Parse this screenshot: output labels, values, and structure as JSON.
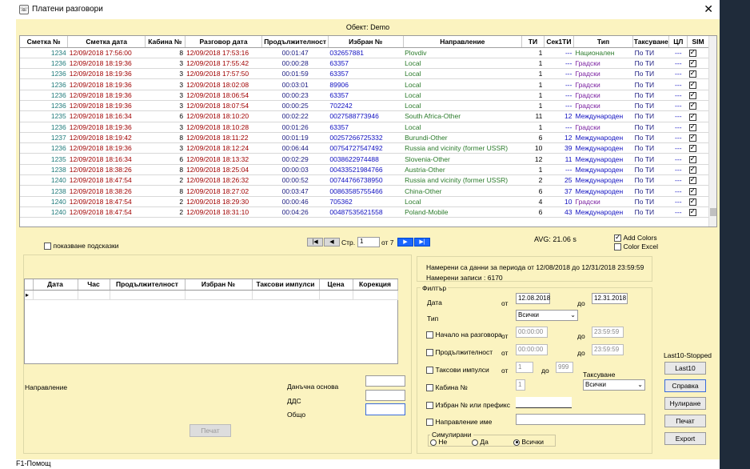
{
  "window": {
    "title": "Платени разговори",
    "close_glyph": "✕",
    "app_icon": "phone-icon"
  },
  "object_label": "Обект: Demo",
  "grid": {
    "columns": [
      "Сметка №",
      "Сметка дата",
      "Кабина №",
      "Разговор дата",
      "Продължителност",
      "Избран №",
      "Направление",
      "ТИ",
      "Сек1ТИ",
      "Тип",
      "Таксуване",
      "ЦЛ",
      "SIM"
    ],
    "rows": [
      {
        "acct": "1234",
        "acct_date": "12/09/2018  17:56:00",
        "booth": "8",
        "call_date": "12/09/2018  17:53:16",
        "dur": "00:01:47",
        "num": "032657881",
        "dest": "Plovdiv",
        "ti": "1",
        "sec": "---",
        "type": "Национален",
        "tax": "По ТИ",
        "cl": "---",
        "sim": true
      },
      {
        "acct": "1236",
        "acct_date": "12/09/2018  18:19:36",
        "booth": "3",
        "call_date": "12/09/2018  17:55:42",
        "dur": "00:00:28",
        "num": "63357",
        "dest": "Local",
        "ti": "1",
        "sec": "---",
        "type": "Градски",
        "tax": "По ТИ",
        "cl": "---",
        "sim": true
      },
      {
        "acct": "1236",
        "acct_date": "12/09/2018  18:19:36",
        "booth": "3",
        "call_date": "12/09/2018  17:57:50",
        "dur": "00:01:59",
        "num": "63357",
        "dest": "Local",
        "ti": "1",
        "sec": "---",
        "type": "Градски",
        "tax": "По ТИ",
        "cl": "---",
        "sim": true
      },
      {
        "acct": "1236",
        "acct_date": "12/09/2018  18:19:36",
        "booth": "3",
        "call_date": "12/09/2018  18:02:08",
        "dur": "00:03:01",
        "num": "89906",
        "dest": "Local",
        "ti": "1",
        "sec": "---",
        "type": "Градски",
        "tax": "По ТИ",
        "cl": "---",
        "sim": true
      },
      {
        "acct": "1236",
        "acct_date": "12/09/2018  18:19:36",
        "booth": "3",
        "call_date": "12/09/2018  18:06:54",
        "dur": "00:00:23",
        "num": "63357",
        "dest": "Local",
        "ti": "1",
        "sec": "---",
        "type": "Градски",
        "tax": "По ТИ",
        "cl": "---",
        "sim": true
      },
      {
        "acct": "1236",
        "acct_date": "12/09/2018  18:19:36",
        "booth": "3",
        "call_date": "12/09/2018  18:07:54",
        "dur": "00:00:25",
        "num": "702242",
        "dest": "Local",
        "ti": "1",
        "sec": "---",
        "type": "Градски",
        "tax": "По ТИ",
        "cl": "---",
        "sim": true
      },
      {
        "acct": "1235",
        "acct_date": "12/09/2018  18:16:34",
        "booth": "6",
        "call_date": "12/09/2018  18:10:20",
        "dur": "00:02:22",
        "num": "0027588773946",
        "dest": "South Africa-Other",
        "ti": "11",
        "sec": "12",
        "type": "Международен",
        "tax": "По ТИ",
        "cl": "---",
        "sim": true
      },
      {
        "acct": "1236",
        "acct_date": "12/09/2018  18:19:36",
        "booth": "3",
        "call_date": "12/09/2018  18:10:28",
        "dur": "00:01:26",
        "num": "63357",
        "dest": "Local",
        "ti": "1",
        "sec": "---",
        "type": "Градски",
        "tax": "По ТИ",
        "cl": "---",
        "sim": true
      },
      {
        "acct": "1237",
        "acct_date": "12/09/2018  18:19:42",
        "booth": "8",
        "call_date": "12/09/2018  18:11:22",
        "dur": "00:01:19",
        "num": "00257266725332",
        "dest": "Burundi-Other",
        "ti": "6",
        "sec": "12",
        "type": "Международен",
        "tax": "По ТИ",
        "cl": "---",
        "sim": true
      },
      {
        "acct": "1236",
        "acct_date": "12/09/2018  18:19:36",
        "booth": "3",
        "call_date": "12/09/2018  18:12:24",
        "dur": "00:06:44",
        "num": "00754727547492",
        "dest": "Russia and vicinity (former USSR)",
        "ti": "10",
        "sec": "39",
        "type": "Международен",
        "tax": "По ТИ",
        "cl": "---",
        "sim": true
      },
      {
        "acct": "1235",
        "acct_date": "12/09/2018  18:16:34",
        "booth": "6",
        "call_date": "12/09/2018  18:13:32",
        "dur": "00:02:29",
        "num": "0038622974488",
        "dest": "Slovenia-Other",
        "ti": "12",
        "sec": "11",
        "type": "Международен",
        "tax": "По ТИ",
        "cl": "---",
        "sim": true
      },
      {
        "acct": "1238",
        "acct_date": "12/09/2018  18:38:26",
        "booth": "8",
        "call_date": "12/09/2018  18:25:04",
        "dur": "00:00:03",
        "num": "00433521984766",
        "dest": "Austria-Other",
        "ti": "1",
        "sec": "---",
        "type": "Международен",
        "tax": "По ТИ",
        "cl": "---",
        "sim": true
      },
      {
        "acct": "1240",
        "acct_date": "12/09/2018  18:47:54",
        "booth": "2",
        "call_date": "12/09/2018  18:26:32",
        "dur": "00:00:52",
        "num": "00744766738950",
        "dest": "Russia and vicinity (former USSR)",
        "ti": "2",
        "sec": "25",
        "type": "Международен",
        "tax": "По ТИ",
        "cl": "---",
        "sim": true
      },
      {
        "acct": "1238",
        "acct_date": "12/09/2018  18:38:26",
        "booth": "8",
        "call_date": "12/09/2018  18:27:02",
        "dur": "00:03:47",
        "num": "00863585755466",
        "dest": "China-Other",
        "ti": "6",
        "sec": "37",
        "type": "Международен",
        "tax": "По ТИ",
        "cl": "---",
        "sim": true
      },
      {
        "acct": "1240",
        "acct_date": "12/09/2018  18:47:54",
        "booth": "2",
        "call_date": "12/09/2018  18:29:30",
        "dur": "00:00:46",
        "num": "705362",
        "dest": "Local",
        "ti": "4",
        "sec": "10",
        "type": "Градски",
        "tax": "По ТИ",
        "cl": "---",
        "sim": true
      },
      {
        "acct": "1240",
        "acct_date": "12/09/2018  18:47:54",
        "booth": "2",
        "call_date": "12/09/2018  18:31:10",
        "dur": "00:04:26",
        "num": "00487535621558",
        "dest": "Poland-Mobile",
        "ti": "6",
        "sec": "43",
        "type": "Международен",
        "tax": "По ТИ",
        "cl": "---",
        "sim": true
      }
    ]
  },
  "hints_label": "показване подсказки",
  "pager": {
    "prev_first": "|◀",
    "prev": "◀",
    "page_label": "Стр.",
    "page_value": "1",
    "of_label": "от 7",
    "next": "▶",
    "next_last": "▶|"
  },
  "avg": "AVG:   21.06 s",
  "add_colors": "Add Colors",
  "color_excel": "Color Excel",
  "detail_grid": {
    "columns": [
      "Дата",
      "Час",
      "Продължителност",
      "Избран №",
      "Таксови импулси",
      "Цена",
      "Корекция"
    ]
  },
  "direction_label": "Направление",
  "totals": {
    "tax_base": "Данъчна основа",
    "vat": "ДДС",
    "total": "Общо"
  },
  "print_button_disabled": "Печат",
  "found_period": "Намерени са данни за периода от  12/08/2018  до 12/31/2018 23:59:59",
  "found_records": "Намерени записи : 6170",
  "filter": {
    "title": "Филтър",
    "date_label": "Дата",
    "from": "от",
    "to": "до",
    "date_from": "12.08.2018",
    "date_to": "12.31.2018",
    "type_label": "Тип",
    "type_value": "Всички",
    "start_label": "Начало на разговора",
    "start_from": "00:00:00",
    "start_to": "23:59:59",
    "dur_label": "Продължителност",
    "dur_from": "00:00:00",
    "dur_to": "23:59:59",
    "pulses_label": "Таксови импулси",
    "pulses_from": "1",
    "pulses_to": "999",
    "booth_label": "Кабина №",
    "booth_value": "1",
    "taxation_label": "Таксуване",
    "taxation_value": "Всички",
    "number_label": "Избран № или префикс",
    "dest_label": "Направление име",
    "simulated_label": "Симулирани",
    "radio_no": "Не",
    "radio_yes": "Да",
    "radio_all": "Всички"
  },
  "side": {
    "status": "Last10-Stopped",
    "last10": "Last10",
    "help": "Справка",
    "reset": "Нулиране",
    "print": "Печат",
    "export": "Export"
  },
  "statusbar": "F1-Помощ",
  "colors": {
    "bg": "#fbf3c0",
    "teal": "#1f7a7a",
    "red": "#a00000",
    "blue": "#1010c0",
    "green": "#2a7a2a",
    "purple": "#7a20a0"
  }
}
